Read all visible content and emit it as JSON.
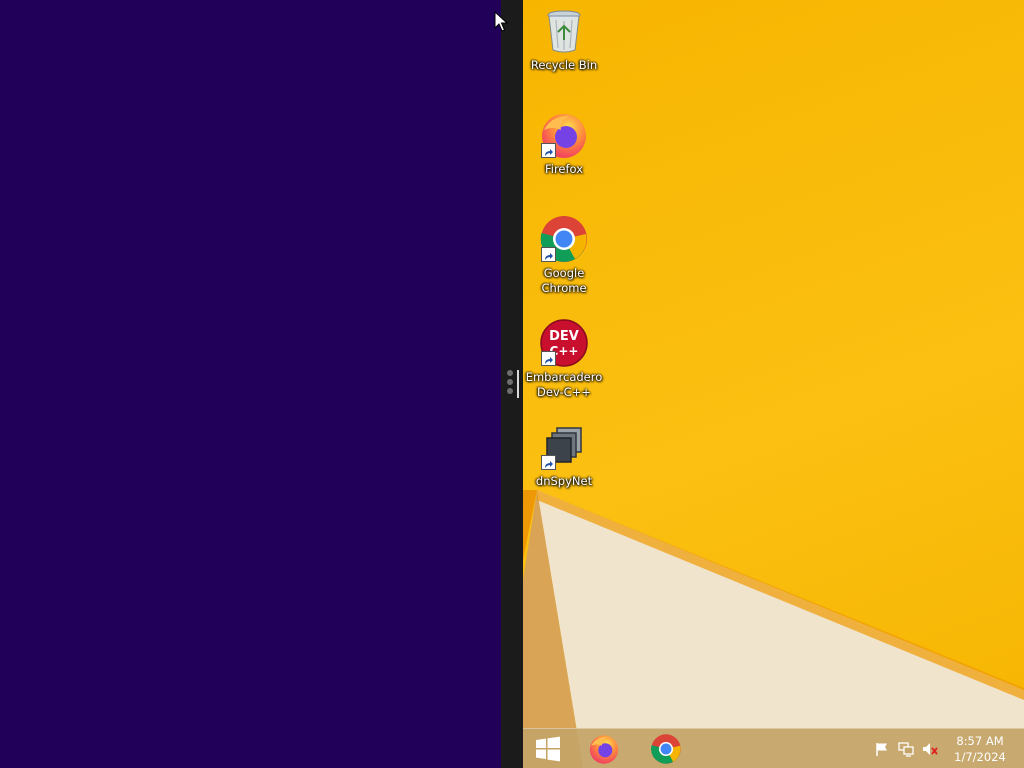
{
  "desktop": {
    "icons": [
      {
        "label": "Recycle Bin",
        "icon": "recycle-bin-icon"
      },
      {
        "label": "Firefox",
        "icon": "firefox-icon"
      },
      {
        "label": "Google Chrome",
        "icon": "chrome-icon"
      },
      {
        "label": "Embarcadero Dev-C++",
        "icon": "devcpp-icon",
        "icon_text": "DEV C++"
      },
      {
        "label": "dnSpyNet",
        "icon": "dnspy-icon"
      }
    ]
  },
  "taskbar": {
    "items": [
      {
        "name": "start-button",
        "icon": "windows-logo-icon"
      },
      {
        "name": "firefox-taskbar-button",
        "icon": "firefox-icon"
      },
      {
        "name": "chrome-taskbar-button",
        "icon": "chrome-icon"
      }
    ],
    "tray": [
      {
        "icon": "action-center-flag-icon"
      },
      {
        "icon": "network-icon"
      },
      {
        "icon": "speaker-muted-icon"
      }
    ],
    "clock": {
      "time": "8:57 AM",
      "date": "1/7/2024"
    }
  },
  "colors": {
    "left_pane": "#200058",
    "desktop_bg": "#f7b500",
    "taskbar": "#c4a468"
  }
}
